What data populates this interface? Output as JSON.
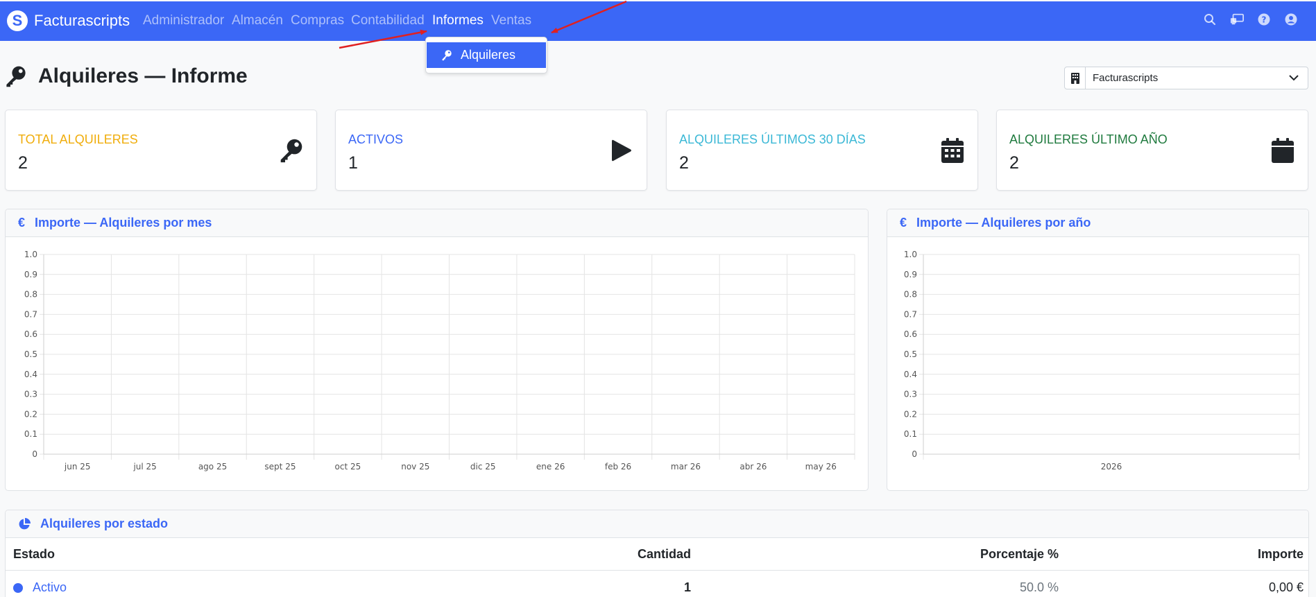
{
  "navbar": {
    "brand": "Facturascripts",
    "brand_logo_letter": "S",
    "items": [
      {
        "label": "Administrador",
        "active": false
      },
      {
        "label": "Almacén",
        "active": false
      },
      {
        "label": "Compras",
        "active": false
      },
      {
        "label": "Contabilidad",
        "active": false
      },
      {
        "label": "Informes",
        "active": true
      },
      {
        "label": "Ventas",
        "active": false
      }
    ],
    "right_icons": [
      "search-icon",
      "screen-share-icon",
      "help-icon",
      "user-icon"
    ]
  },
  "dropdown": {
    "items": [
      {
        "label": "Alquileres",
        "icon": "key-icon",
        "selected": true
      }
    ]
  },
  "page": {
    "title": "Alquileres — Informe",
    "title_icon": "key-icon",
    "company_select": {
      "value": "Facturascripts",
      "icon": "building-icon"
    }
  },
  "stats": [
    {
      "label": "TOTAL ALQUILERES",
      "value": "2",
      "color": "#f0ad0c",
      "icon": "key-icon"
    },
    {
      "label": "ACTIVOS",
      "value": "1",
      "color": "#3b67f6",
      "icon": "play-icon"
    },
    {
      "label": "ALQUILERES ÚLTIMOS 30 DÍAS",
      "value": "2",
      "color": "#3bb8d6",
      "icon": "calendar-days-icon"
    },
    {
      "label": "ALQUILERES ÚLTIMO AÑO",
      "value": "2",
      "color": "#1f7a3e",
      "icon": "calendar-icon"
    }
  ],
  "charts": {
    "monthly": {
      "title": "Importe — Alquileres por mes",
      "icon": "euro-icon"
    },
    "yearly": {
      "title": "Importe — Alquileres por año",
      "icon": "euro-icon"
    }
  },
  "chart_data": [
    {
      "type": "bar",
      "title": "Importe — Alquileres por mes",
      "categories": [
        "jun 25",
        "jul 25",
        "ago 25",
        "sept 25",
        "oct 25",
        "nov 25",
        "dic 25",
        "ene 26",
        "feb 26",
        "mar 26",
        "abr 26",
        "may 26"
      ],
      "values": [
        0,
        0,
        0,
        0,
        0,
        0,
        0,
        0,
        0,
        0,
        0,
        0
      ],
      "yticks": [
        "0",
        "0.1",
        "0.2",
        "0.3",
        "0.4",
        "0.5",
        "0.6",
        "0.7",
        "0.8",
        "0.9",
        "1.0"
      ],
      "ylim": [
        0,
        1
      ],
      "grid": true
    },
    {
      "type": "bar",
      "title": "Importe — Alquileres por año",
      "categories": [
        "2026"
      ],
      "values": [
        0
      ],
      "yticks": [
        "0",
        "0.1",
        "0.2",
        "0.3",
        "0.4",
        "0.5",
        "0.6",
        "0.7",
        "0.8",
        "0.9",
        "1.0"
      ],
      "ylim": [
        0,
        1
      ],
      "grid": true
    }
  ],
  "status_table": {
    "title": "Alquileres por estado",
    "icon": "pie-chart-icon",
    "headers": {
      "estado": "Estado",
      "cantidad": "Cantidad",
      "porcentaje": "Porcentaje %",
      "importe": "Importe"
    },
    "rows": [
      {
        "estado": "Activo",
        "cantidad": "1",
        "porcentaje": "50.0 %",
        "importe": "0,00 €",
        "color": "#3b67f6"
      }
    ]
  }
}
